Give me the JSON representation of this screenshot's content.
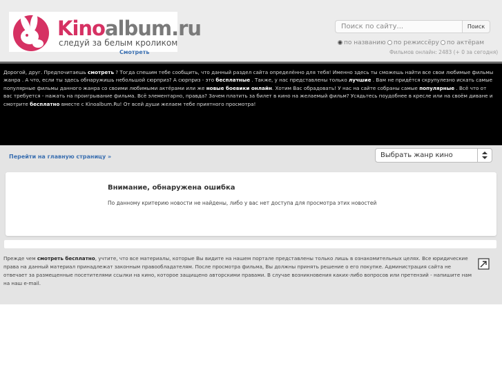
{
  "header": {
    "logo": {
      "word_kino": "Kino",
      "word_rest": "album.ru",
      "tagline": "следуй за белым кроликом"
    },
    "watch_link": "Смотреть",
    "search": {
      "placeholder": "Поиск по сайту...",
      "button": "Поиск",
      "options": [
        {
          "label": "по названию",
          "selected": true
        },
        {
          "label": "по режиссёру",
          "selected": false
        },
        {
          "label": "по актёрам",
          "selected": false
        }
      ]
    },
    "films_online": "Фильмов онлайн: 2483 (+ 0 за сегодня)"
  },
  "intro": {
    "t1": "Дорогой, друг. Предпочитаешь ",
    "b1": "смотреть",
    "t2": " ? Тогда спешим тебе сообщить, что данный раздел сайта определённо для тебя! Именно здесь ты сможешь найти все свои любимые фильмы жанра . А что, если ты здесь обнаружишь небольшой сюрприз? А сюрприз - это ",
    "b2": "бесплатные",
    "t3": " . Также, у нас представлены только ",
    "b3": "лучшие",
    "t4": " . Вам не придётся скрупулезно искать самые популярные фильмы данного жанра со своими любимыми актёрами или же ",
    "b4": "новые боевики онлайн",
    "t5": ". Хотим Вас обрадовать! У нас на сайте собраны самые ",
    "b5": "популярные",
    "t6": " . Всё что от вас требуется - нажать на проигрывание фильма. Всё элементарно, правда? Зачем платить за билет в кино на желаемый фильм? Усядьтесь поудобнее в кресле или на своём диване и смотрите ",
    "b6": "бесплатно",
    "t7": " вместе с Kinoalbum.Ru! От всей души желаем тебе приятного просмотра!"
  },
  "nav": {
    "home_link": "Перейти на главную страницу »",
    "genre_select": "Выбрать жанр кино"
  },
  "error": {
    "title": "Внимание, обнаружена ошибка",
    "message": "По данному критерию новости не найдены, либо у вас нет доступа для просмотра этих новостей"
  },
  "footer": {
    "t1": "Прежде чем ",
    "b1": "смотреть бесплатно",
    "t2": ", учтите, что все материалы, которые Вы видите на нашем портале представлены только лишь в ознакомительных целях. Все юридические права на данный материал принадлежат законным правообладателям. После просмотра фильма, Вы должны принять решение о его покупке. Администрация сайта не отвечает за размещенные посетителями ссылки на кино, которое защищено авторскими правами. В случае возникновения каких-либо вопросов или претензий - напишите нам на наш e-mail."
  },
  "colors": {
    "brand_pink": "#d63163",
    "link_blue": "#3a6fb0",
    "band_black": "#000000"
  },
  "icons": {
    "logo": "rabbit-logo-icon",
    "share": "external-link-icon",
    "select_arrow": "up-down-arrow-icon"
  }
}
